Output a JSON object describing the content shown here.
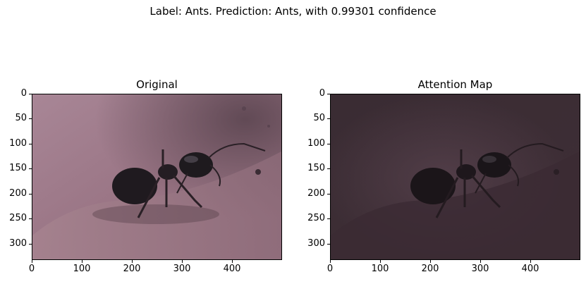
{
  "suptitle": "Label: Ants. Prediction: Ants, with 0.99301 confidence",
  "panels": [
    {
      "title": "Original",
      "image": "ant-photo",
      "tone": "original"
    },
    {
      "title": "Attention Map",
      "image": "ant-photo-attention",
      "tone": "dimmed"
    }
  ],
  "axes": {
    "yticks": [
      "0",
      "50",
      "100",
      "150",
      "200",
      "250",
      "300"
    ],
    "xticks": [
      "0",
      "100",
      "200",
      "300",
      "400"
    ],
    "y_values": [
      0,
      50,
      100,
      150,
      200,
      250,
      300
    ],
    "x_values": [
      0,
      100,
      200,
      300,
      400
    ],
    "xlim": [
      0,
      500
    ],
    "ylim": [
      333,
      0
    ]
  }
}
